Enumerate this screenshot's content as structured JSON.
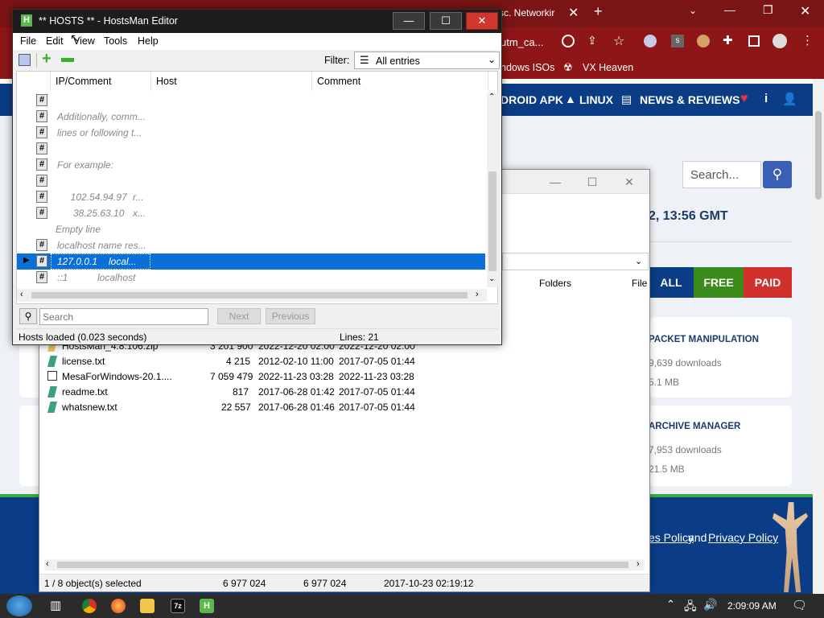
{
  "browser": {
    "tab_title": "sc. Networkir",
    "address_fragment": "utm_ca...",
    "bookmarks": [
      "ndows ISOs",
      "VX Heaven"
    ],
    "site_nav": [
      "DROID APK",
      "LINUX",
      "NEWS & REVIEWS"
    ],
    "search_placeholder": "Search...",
    "time_text": "2, 13:56 GMT",
    "filter_tabs": [
      "ALL",
      "FREE",
      "PAID"
    ],
    "cards": [
      {
        "title": "PACKET MANIPULATION",
        "downloads": "9,639 downloads",
        "size": "5.1 MB"
      },
      {
        "title": "ARCHIVE MANAGER",
        "downloads": "7,953 downloads",
        "size": "21.5 MB"
      }
    ],
    "footer_text": "es Policy",
    "footer_and": "and",
    "footer_link": "Privacy Policy"
  },
  "file_manager": {
    "column_folders": "Folders",
    "column_file": "File",
    "files": [
      {
        "name": "HostsMan_4.8.106.zip",
        "size": "3 201 900",
        "modified": "2022-12-20 02:00",
        "created": "2022-12-20 02:00"
      },
      {
        "name": "license.txt",
        "size": "4 215",
        "modified": "2012-02-10 11:00",
        "created": "2017-07-05 01:44"
      },
      {
        "name": "MesaForWindows-20.1....",
        "size": "7 059 479",
        "modified": "2022-11-23 03:28",
        "created": "2022-11-23 03:28"
      },
      {
        "name": "readme.txt",
        "size": "817",
        "modified": "2017-06-28 01:42",
        "created": "2017-07-05 01:44"
      },
      {
        "name": "whatsnew.txt",
        "size": "22 557",
        "modified": "2017-06-28 01:46",
        "created": "2017-07-05 01:44"
      }
    ],
    "status": {
      "selected": "1 / 8 object(s) selected",
      "size1": "6 977 024",
      "size2": "6 977 024",
      "date": "2017-10-23 02:19:12"
    }
  },
  "hostsman": {
    "title": "** HOSTS ** - HostsMan Editor",
    "menu": [
      "File",
      "Edit",
      "View",
      "Tools",
      "Help"
    ],
    "filter_label": "Filter:",
    "filter_value": "All entries",
    "columns": [
      "IP/Comment",
      "Host",
      "Comment"
    ],
    "rows": [
      {
        "hash": true,
        "text": "",
        "host": ""
      },
      {
        "hash": true,
        "text": "Additionally, comm...",
        "host": ""
      },
      {
        "hash": true,
        "text": "lines or following t...",
        "host": ""
      },
      {
        "hash": true,
        "text": "",
        "host": ""
      },
      {
        "hash": true,
        "text": "For example:",
        "host": ""
      },
      {
        "hash": true,
        "text": "",
        "host": ""
      },
      {
        "hash": true,
        "text": "     102.54.94.97",
        "host": "r..."
      },
      {
        "hash": true,
        "text": "      38.25.63.10",
        "host": "x..."
      },
      {
        "hash": false,
        "text": "Empty line",
        "host": ""
      },
      {
        "hash": true,
        "text": "localhost name res...",
        "host": ""
      },
      {
        "hash": true,
        "text": "127.0.0.1",
        "host": "local...",
        "selected": true
      },
      {
        "hash": true,
        "text": "::1",
        "host": "localhost"
      }
    ],
    "search_placeholder": "Search",
    "next_label": "Next",
    "previous_label": "Previous",
    "status_left": "Hosts loaded (0.023 seconds)",
    "status_lines": "Lines: 21"
  },
  "taskbar": {
    "clock": "2:09:09 AM"
  }
}
